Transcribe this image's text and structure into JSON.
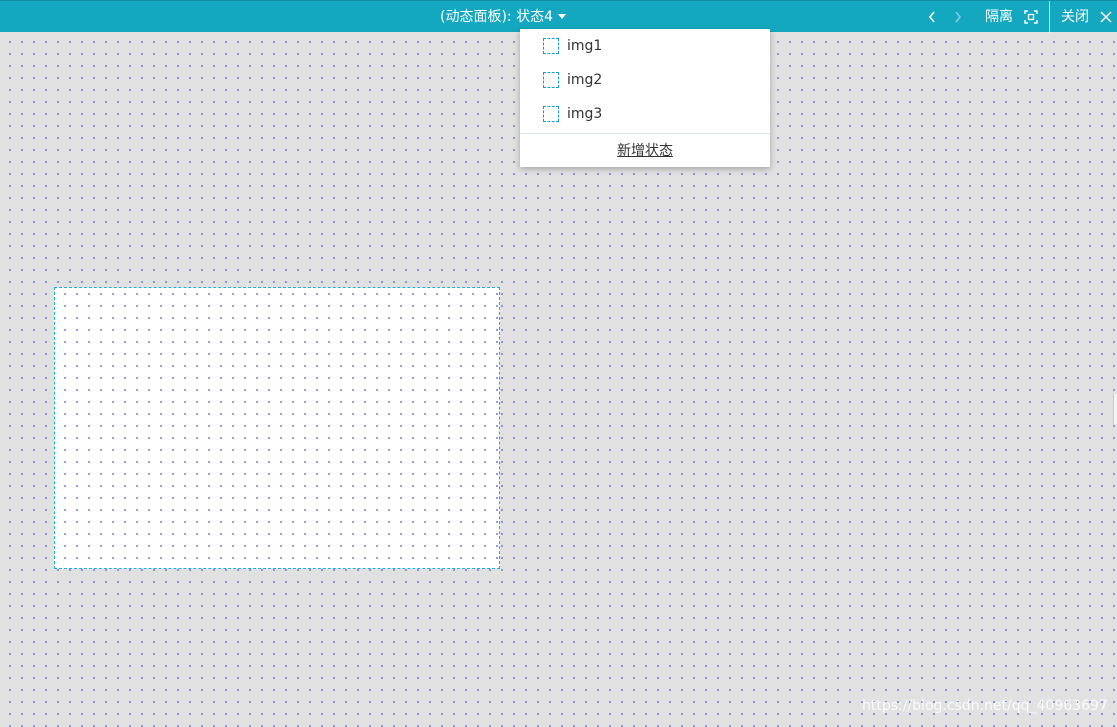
{
  "topbar": {
    "panel_type": "(动态面板):",
    "current_state": "状态4",
    "isolate_label": "隔离",
    "close_label": "关闭"
  },
  "dropdown": {
    "items": [
      {
        "label": "img1"
      },
      {
        "label": "img2"
      },
      {
        "label": "img3"
      }
    ],
    "add_state_label": "新增状态"
  },
  "watermark": "https://blog.csdn.net/qq_40963697",
  "icons": {
    "prev": "chevron-left-icon",
    "next": "chevron-right-icon",
    "isolate": "focus-frame-icon",
    "close": "close-icon",
    "state_dropdown": "caret-down-icon",
    "item_marker": "dashed-box-icon"
  },
  "colors": {
    "toolbar_bg": "#13a8c0",
    "canvas_bg": "#e1e1e1",
    "grid_dot": "#5a6fd6",
    "panel_border": "#19b0d8",
    "item_marker_border": "#1c9ad6"
  }
}
